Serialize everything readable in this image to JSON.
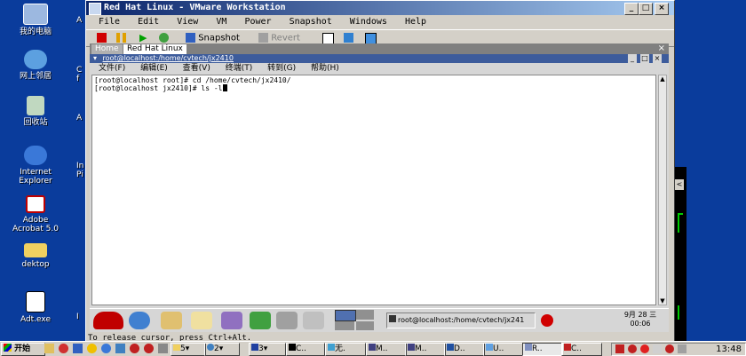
{
  "desktop": {
    "icons": [
      {
        "label": "我的电脑"
      },
      {
        "label": "网上邻居"
      },
      {
        "label": "回收站"
      },
      {
        "label": "Internet\nExplorer"
      },
      {
        "label": "Adobe\nAcrobat 5.0"
      },
      {
        "label": "dektop"
      },
      {
        "label": "Adt.exe"
      }
    ],
    "second_column": [
      "A",
      "C",
      "f",
      "A",
      "In",
      "Pi",
      "I"
    ]
  },
  "vmware": {
    "title": "Red Hat Linux - VMware Workstation",
    "menu": [
      "File",
      "Edit",
      "View",
      "VM",
      "Power",
      "Snapshot",
      "Windows",
      "Help"
    ],
    "toolbar": {
      "snapshot_label": "Snapshot",
      "revert_label": "Revert"
    },
    "tabs": [
      "Home",
      "Red Hat Linux"
    ],
    "status": "To release cursor, press Ctrl+Alt."
  },
  "guest": {
    "terminal_title": "root@localhost:/home/cvtech/jx2410",
    "terminal_menu": [
      "文件(F)",
      "编辑(E)",
      "查看(V)",
      "终端(T)",
      "转到(G)",
      "帮助(H)"
    ],
    "lines": [
      "[root@localhost root]# cd /home/cvtech/jx2410/",
      "[root@localhost jx2410]# ls -l"
    ],
    "task_label": "root@localhost:/home/cvtech/jx241",
    "clock_date": "9月 28",
    "clock_weekday": "三",
    "clock_time": "00:06"
  },
  "taskbar": {
    "start": "开始",
    "items": [
      "5",
      "2",
      "3",
      "C..",
      "无.",
      "M..",
      "M..",
      "D..",
      "U..",
      "R..",
      "C.."
    ],
    "time": "13:48"
  },
  "colors": {
    "desktop_bg": "#0a3c9c",
    "title_start": "#0a246a",
    "title_end": "#a6caf0",
    "terminal_title": "#3d5c9c"
  }
}
